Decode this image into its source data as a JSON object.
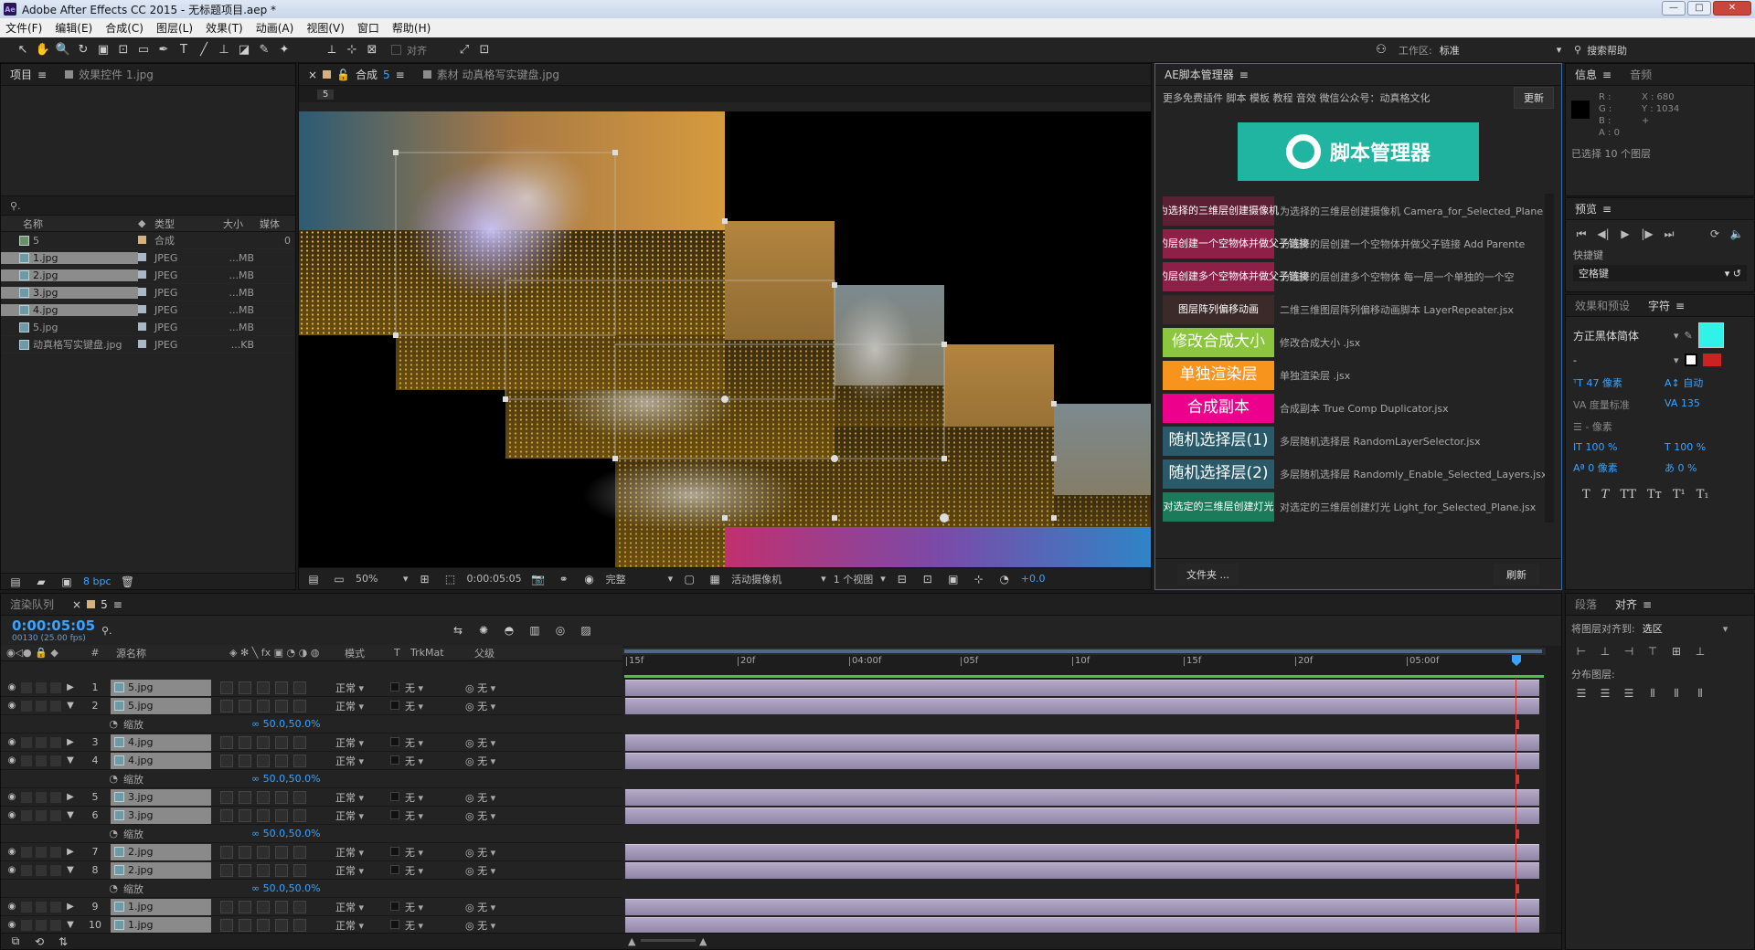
{
  "app": {
    "title": "Adobe After Effects CC 2015 - 无标题项目.aep *",
    "logo": "Ae",
    "win_min": "—",
    "win_max": "□",
    "win_close": "✕"
  },
  "menu": [
    "文件(F)",
    "编辑(E)",
    "合成(C)",
    "图层(L)",
    "效果(T)",
    "动画(A)",
    "视图(V)",
    "窗口",
    "帮助(H)"
  ],
  "toolbar": {
    "align_label": "对齐",
    "workspace_label": "工作区:",
    "workspace_value": "标准",
    "search_help": "搜索帮助"
  },
  "project_panel": {
    "tab_project": "项目",
    "tab_effects": "效果控件 1.jpg",
    "search_placeholder": "",
    "columns": {
      "name": "名称",
      "type": "类型",
      "size": "大小",
      "media": "媒体"
    },
    "items": [
      {
        "name": "5",
        "type": "合成",
        "size": "",
        "extra": "0",
        "kind": "comp",
        "selected": false
      },
      {
        "name": "1.jpg",
        "type": "JPEG",
        "size": "...MB",
        "kind": "img",
        "selected": true
      },
      {
        "name": "2.jpg",
        "type": "JPEG",
        "size": "...MB",
        "kind": "img",
        "selected": true
      },
      {
        "name": "3.jpg",
        "type": "JPEG",
        "size": "...MB",
        "kind": "img",
        "selected": true
      },
      {
        "name": "4.jpg",
        "type": "JPEG",
        "size": "...MB",
        "kind": "img",
        "selected": true
      },
      {
        "name": "5.jpg",
        "type": "JPEG",
        "size": "...MB",
        "kind": "img",
        "selected": false
      },
      {
        "name": "动真格写实键盘.jpg",
        "type": "JPEG",
        "size": "...KB",
        "kind": "img",
        "selected": false
      }
    ],
    "bpc": "8 bpc"
  },
  "comp_panel": {
    "tab_comp_prefix": "合成",
    "tab_comp_num": "5",
    "tab_footage": "素材 动真格写实键盘.jpg",
    "crumb": "5",
    "zoom": "50%",
    "timecode": "0:00:05:05",
    "quality": "完整",
    "camera": "活动摄像机",
    "views": "1 个视图",
    "exposure": "+0.0"
  },
  "script_manager": {
    "tab": "AE脚本管理器",
    "notice": "更多免费插件 脚本 模板 教程 音效 微信公众号：动真格文化",
    "update_btn": "更新",
    "banner": "脚本管理器",
    "scripts": [
      {
        "label": "为选择的三维层创建摄像机",
        "desc": "为选择的三维层创建摄像机 Camera_for_Selected_Plane",
        "color": "#5d1f33",
        "big": false
      },
      {
        "label": "为选择的层创建一个空物体并做父子链接",
        "desc": "为选择的层创建一个空物体并做父子链接 Add Parente",
        "color": "#8e1f47",
        "big": false
      },
      {
        "label": "为选择的层创建多个空物体并做父子链接",
        "desc": "为选择的层创建多个空物体 每一层一个单独的一个空",
        "color": "#8e1f47",
        "big": false
      },
      {
        "label": "图层阵列偏移动画",
        "desc": "二维三维图层阵列偏移动画脚本 LayerRepeater.jsx",
        "color": "#3c2a2a",
        "big": false
      },
      {
        "label": "修改合成大小",
        "desc": "修改合成大小 .jsx",
        "color": "#8cc63f",
        "big": true
      },
      {
        "label": "单独渲染层",
        "desc": "单独渲染层 .jsx",
        "color": "#f7941d",
        "big": true
      },
      {
        "label": "合成副本",
        "desc": "合成副本 True Comp Duplicator.jsx",
        "color": "#ec008c",
        "big": true
      },
      {
        "label": "随机选择层(1)",
        "desc": "多层随机选择层 RandomLayerSelector.jsx",
        "color": "#2a5a6a",
        "big": true
      },
      {
        "label": "随机选择层(2)",
        "desc": "多层随机选择层 Randomly_Enable_Selected_Layers.jsx",
        "color": "#2a5a6a",
        "big": true
      },
      {
        "label": "对选定的三维层创建灯光",
        "desc": "对选定的三维层创建灯光 Light_for_Selected_Plane.jsx",
        "color": "#1a7a5a",
        "big": false
      }
    ],
    "folder_btn": "文件夹 ...",
    "refresh_btn": "刷新"
  },
  "info_panel": {
    "tab_info": "信息",
    "tab_audio": "音频",
    "rgba": [
      "R :",
      "G :",
      "B :",
      "A : 0"
    ],
    "x": "X : 680",
    "y": "Y : 1034",
    "selected": "已选择 10 个图层"
  },
  "preview_panel": {
    "tab": "预览",
    "shortcut_label": "快捷键",
    "shortcut_value": "空格键"
  },
  "char_panel": {
    "tab_effects": "效果和预设",
    "tab_char": "字符",
    "font": "方正黑体简体",
    "font_style": "-",
    "size": "47 像素",
    "leading": "自动",
    "kerning": "度量标准",
    "tracking": "135",
    "stroke": "- 像素",
    "vscale": "100 %",
    "hscale": "100 %",
    "baseline": "0 像素",
    "tsume": "0 %",
    "fill_color": "#2ff3e8"
  },
  "align_panel": {
    "tab_para": "段落",
    "tab_align": "对齐",
    "align_to_label": "将图层对齐到:",
    "align_to_value": "选区",
    "distribute_label": "分布图层:"
  },
  "timeline": {
    "tab_render": "渲染队列",
    "tab_comp": "5",
    "timecode": "0:00:05:05",
    "frames": "00130 (25.00 fps)",
    "columns": {
      "num": "#",
      "source": "源名称",
      "mode": "模式",
      "t": "T",
      "trkmat": "TrkMat",
      "parent": "父级"
    },
    "ruler": [
      "15f",
      "20f",
      "04:00f",
      "05f",
      "10f",
      "15f",
      "20f",
      "05:00f"
    ],
    "scale_label": "缩放",
    "scale_value": "50.0,50.0%",
    "mode_value": "正常",
    "none_value": "无",
    "layers": [
      {
        "num": "1",
        "name": "5.jpg",
        "expanded": false
      },
      {
        "num": "2",
        "name": "5.jpg",
        "expanded": true
      },
      {
        "num": "3",
        "name": "4.jpg",
        "expanded": false
      },
      {
        "num": "4",
        "name": "4.jpg",
        "expanded": true
      },
      {
        "num": "5",
        "name": "3.jpg",
        "expanded": false
      },
      {
        "num": "6",
        "name": "3.jpg",
        "expanded": true
      },
      {
        "num": "7",
        "name": "2.jpg",
        "expanded": false
      },
      {
        "num": "8",
        "name": "2.jpg",
        "expanded": true
      },
      {
        "num": "9",
        "name": "1.jpg",
        "expanded": false
      },
      {
        "num": "10",
        "name": "1.jpg",
        "expanded": true
      }
    ]
  },
  "colors": {
    "accent_blue": "#3aa3ff",
    "banner_teal": "#1fb5a0",
    "playhead": "#d23a3a",
    "layer_bar": "#a79cbc"
  }
}
